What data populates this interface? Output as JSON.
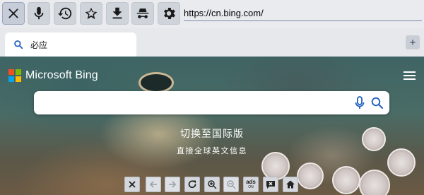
{
  "toolbar": {
    "buttons": [
      {
        "name": "close-icon",
        "label": "close"
      },
      {
        "name": "microphone-icon",
        "label": "voice"
      },
      {
        "name": "history-icon",
        "label": "history"
      },
      {
        "name": "star-icon",
        "label": "bookmarks"
      },
      {
        "name": "download-icon",
        "label": "downloads"
      },
      {
        "name": "incognito-icon",
        "label": "incognito"
      },
      {
        "name": "gear-icon",
        "label": "settings"
      }
    ],
    "url": "https://cn.bing.com/"
  },
  "tabs": [
    {
      "title": "必应",
      "icon": "search-icon",
      "active": true
    }
  ],
  "new_tab_label": "+",
  "page": {
    "brand": "Microsoft Bing",
    "brand_colors": [
      "#f25022",
      "#7fba00",
      "#00a4ef",
      "#ffb900"
    ],
    "search": {
      "placeholder": "",
      "value": ""
    },
    "switch_region": "切换至国际版",
    "switch_subtitle": "直接全球英文信息"
  },
  "bottom_bar": {
    "buttons": [
      {
        "name": "close-icon",
        "enabled": true
      },
      {
        "name": "back-arrow-icon",
        "enabled": false
      },
      {
        "name": "forward-arrow-icon",
        "enabled": false
      },
      {
        "name": "reload-icon",
        "enabled": true
      },
      {
        "name": "zoom-in-icon",
        "enabled": true
      },
      {
        "name": "zoom-out-icon",
        "enabled": false
      },
      {
        "name": "adblock-icon",
        "enabled": true,
        "label": "ads",
        "sublabel": "ON"
      },
      {
        "name": "comment-close-icon",
        "enabled": true
      },
      {
        "name": "home-icon",
        "enabled": true
      }
    ]
  }
}
